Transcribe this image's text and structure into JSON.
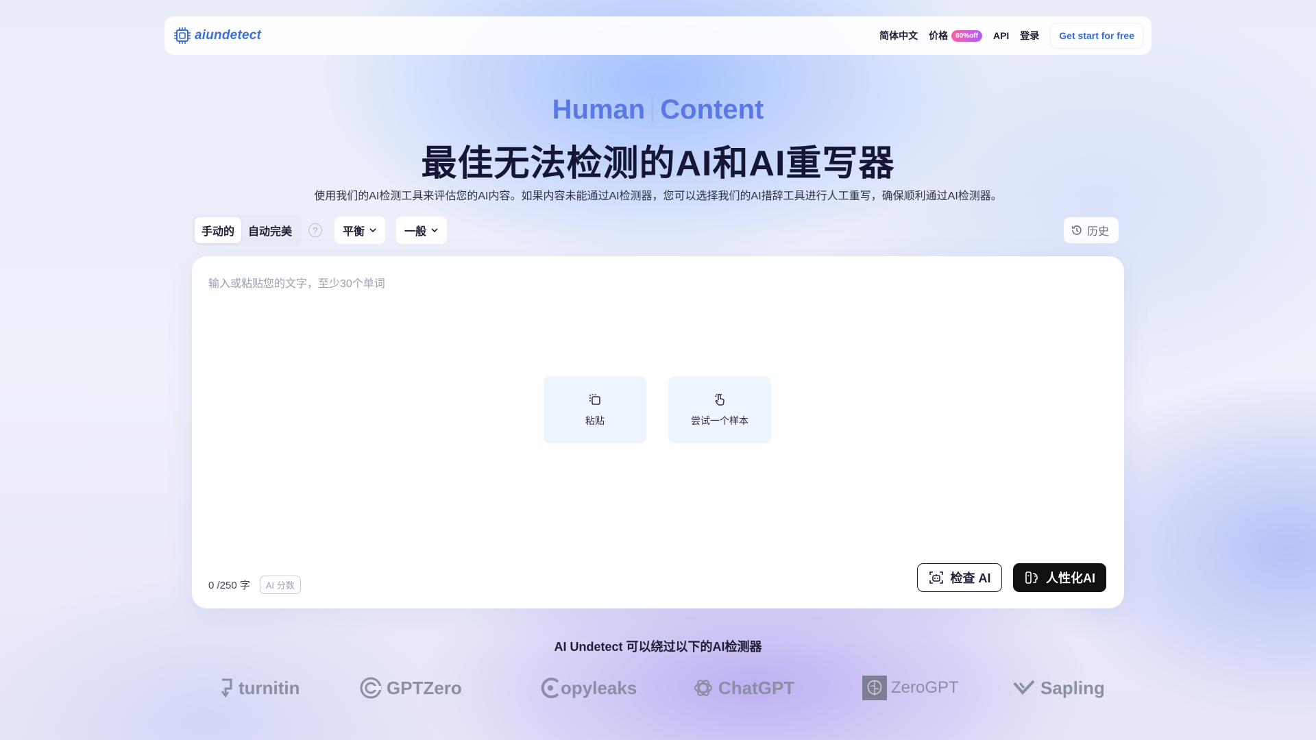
{
  "nav": {
    "brand": "aiundetect",
    "language": "简体中文",
    "pricing": "价格",
    "pricing_badge": "60%off",
    "api": "API",
    "login": "登录",
    "cta": "Get start for free"
  },
  "hero": {
    "title_word_1": "Human",
    "title_word_2": "Content",
    "headline": "最佳无法检测的AI和AI重写器",
    "subtitle": "使用我们的AI检测工具来评估您的AI内容。如果内容未能通过AI检测器，您可以选择我们的AI措辞工具进行人工重写，确保顺利通过AI检测器。"
  },
  "toolbar": {
    "mode_manual": "手动的",
    "mode_auto": "自动完美",
    "help": "?",
    "dropdown_1": "平衡",
    "dropdown_2": "一般",
    "history": "历史"
  },
  "editor": {
    "placeholder": "输入或粘贴您的文字，至少30个单词",
    "paste_label": "粘贴",
    "sample_label": "尝试一个样本",
    "word_count": "0 /250 字",
    "ai_score_label": "AI 分数",
    "check_button": "检查 AI",
    "humanize_button": "人性化AI"
  },
  "bypass": {
    "title": "AI Undetect 可以绕过以下的AI检测器",
    "logos": [
      "turnitin",
      "GPTZero",
      "opyleaks",
      "ChatGPT",
      "ZeroGPT",
      "Sapling"
    ]
  },
  "colors": {
    "brand": "#3a6fd8",
    "hero_accent": "#5b79e6",
    "dark_button": "#111111"
  }
}
